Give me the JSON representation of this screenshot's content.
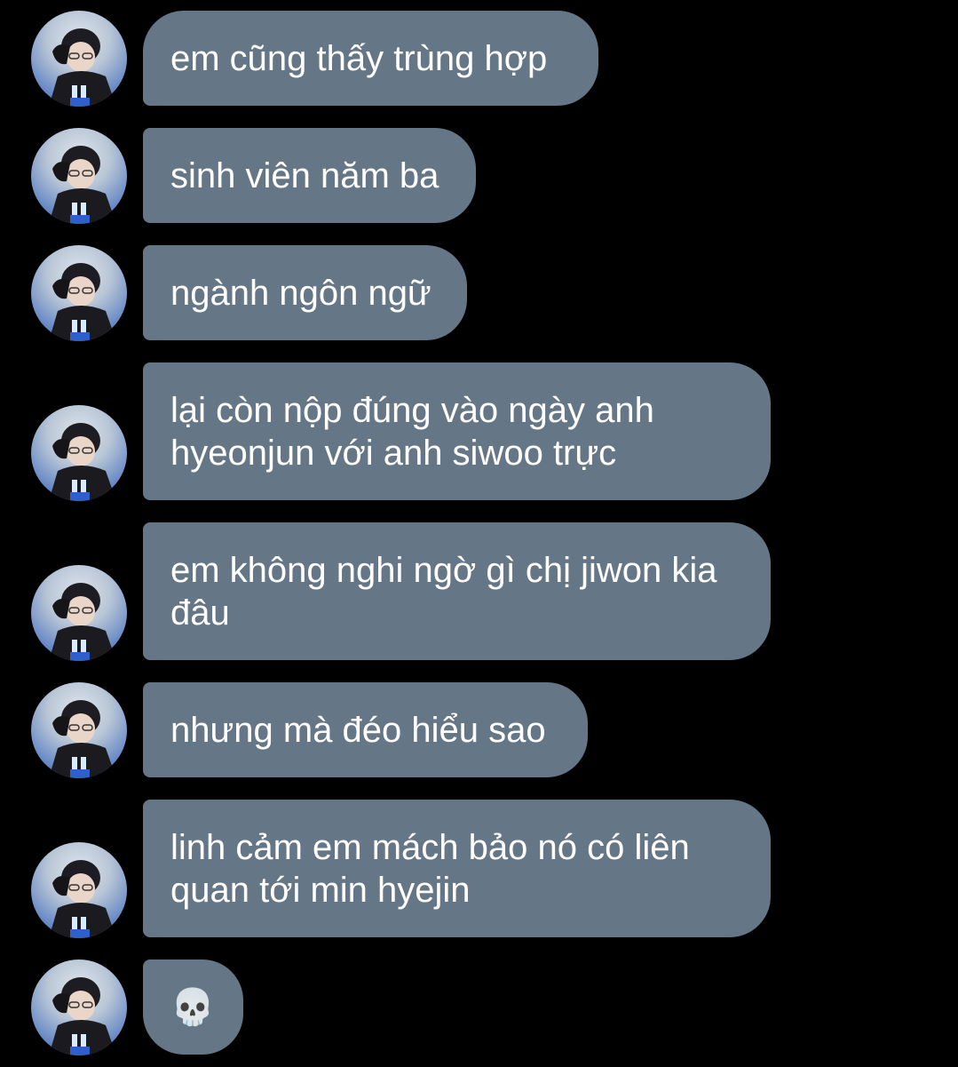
{
  "conversation": {
    "messages": [
      {
        "text": "em cũng thấy trùng hợp",
        "avatar_icon": "profile-photo"
      },
      {
        "text": "sinh viên năm ba",
        "avatar_icon": "profile-photo"
      },
      {
        "text": "ngành ngôn ngữ",
        "avatar_icon": "profile-photo"
      },
      {
        "text": "lại còn nộp đúng vào ngày anh\nhyeonjun với anh siwoo trực",
        "avatar_icon": "profile-photo"
      },
      {
        "text": "em không nghi ngờ gì chị jiwon kia\nđâu",
        "avatar_icon": "profile-photo"
      },
      {
        "text": "nhưng mà đéo hiểu sao",
        "avatar_icon": "profile-photo"
      },
      {
        "text": "linh cảm em mách bảo nó có liên\nquan tới min hyejin",
        "avatar_icon": "profile-photo"
      },
      {
        "text": "💀",
        "avatar_icon": "profile-photo"
      }
    ]
  },
  "colors": {
    "background": "#000000",
    "bubble": "#657687",
    "text": "#ffffff"
  }
}
